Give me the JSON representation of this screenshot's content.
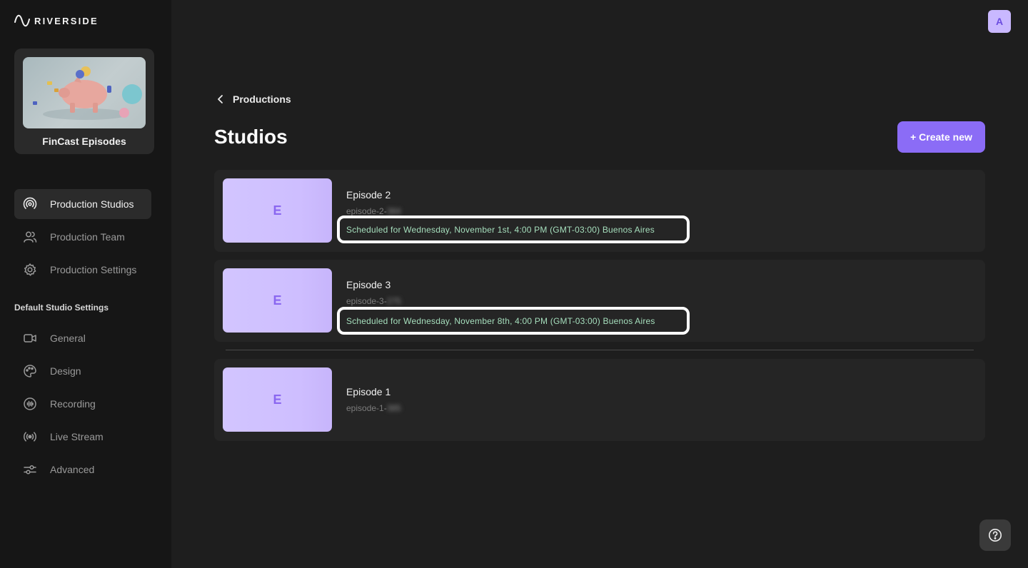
{
  "brand": {
    "logo_text": "RIVERSIDE"
  },
  "production": {
    "name": "FinCast Episodes"
  },
  "nav": {
    "main": [
      {
        "label": "Production Studios",
        "icon": "podcast-icon",
        "active": true
      },
      {
        "label": "Production Team",
        "icon": "users-icon"
      },
      {
        "label": "Production Settings",
        "icon": "gear-icon"
      }
    ],
    "section_label": "Default Studio Settings",
    "settings": [
      {
        "label": "General",
        "icon": "camera-icon"
      },
      {
        "label": "Design",
        "icon": "palette-icon"
      },
      {
        "label": "Recording",
        "icon": "waveform-icon"
      },
      {
        "label": "Live Stream",
        "icon": "broadcast-icon"
      },
      {
        "label": "Advanced",
        "icon": "sliders-icon"
      }
    ]
  },
  "header": {
    "avatar_initial": "A"
  },
  "breadcrumb": {
    "label": "Productions"
  },
  "page": {
    "title": "Studios",
    "create_label": "+ Create new"
  },
  "studios": [
    {
      "initial": "E",
      "name": "Episode 2",
      "slug": "episode-2-",
      "slug_hidden": "384",
      "schedule": "Scheduled for Wednesday, November 1st, 4:00 PM (GMT-03:00) Buenos Aires"
    },
    {
      "initial": "E",
      "name": "Episode 3",
      "slug": "episode-3-",
      "slug_hidden": "275",
      "schedule": "Scheduled for Wednesday, November 8th, 4:00 PM (GMT-03:00) Buenos Aires"
    },
    {
      "initial": "E",
      "name": "Episode 1",
      "slug": "episode-1-",
      "slug_hidden": "385",
      "schedule": ""
    }
  ],
  "colors": {
    "accent": "#8b6cf6",
    "schedule_text": "#a6dfbd",
    "thumb": "#d2c5ff"
  }
}
